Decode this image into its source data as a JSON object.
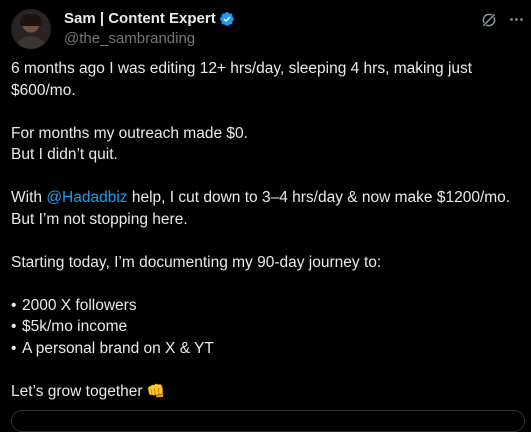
{
  "author": {
    "display_name": "Sam | Content Expert",
    "handle": "@the_sambranding",
    "verified_color": "#1d9bf0"
  },
  "icons": {
    "avatar": "avatar",
    "verified": "verified-badge-icon",
    "grok": "grok-icon",
    "more": "more-icon",
    "fist": "oncoming-fist-emoji"
  },
  "post": {
    "para1": [
      "6 months ago I was editing 12+ hrs/day, sleeping 4 hrs, making just",
      "$600/mo."
    ],
    "para2": [
      "For months my outreach made $0.",
      "But I didn’t quit."
    ],
    "para3_prefix": "With ",
    "para3_mention": "@Hadadbiz",
    "para3_suffix": " help, I cut down to 3–4 hrs/day & now make $1200/mo.",
    "para3_line2": "But I’m not stopping here.",
    "para4": "Starting today, I’m documenting my 90-day journey to:",
    "bullet_char": "•",
    "bullets": [
      "2000 X followers",
      "$5k/mo income",
      "A personal brand on X & YT"
    ],
    "closing": "Let’s grow together",
    "closing_emoji": "👊"
  },
  "colors": {
    "background": "#000000",
    "text": "#e7e9ea",
    "secondary_text": "#71767b",
    "link": "#1d9bf0"
  }
}
